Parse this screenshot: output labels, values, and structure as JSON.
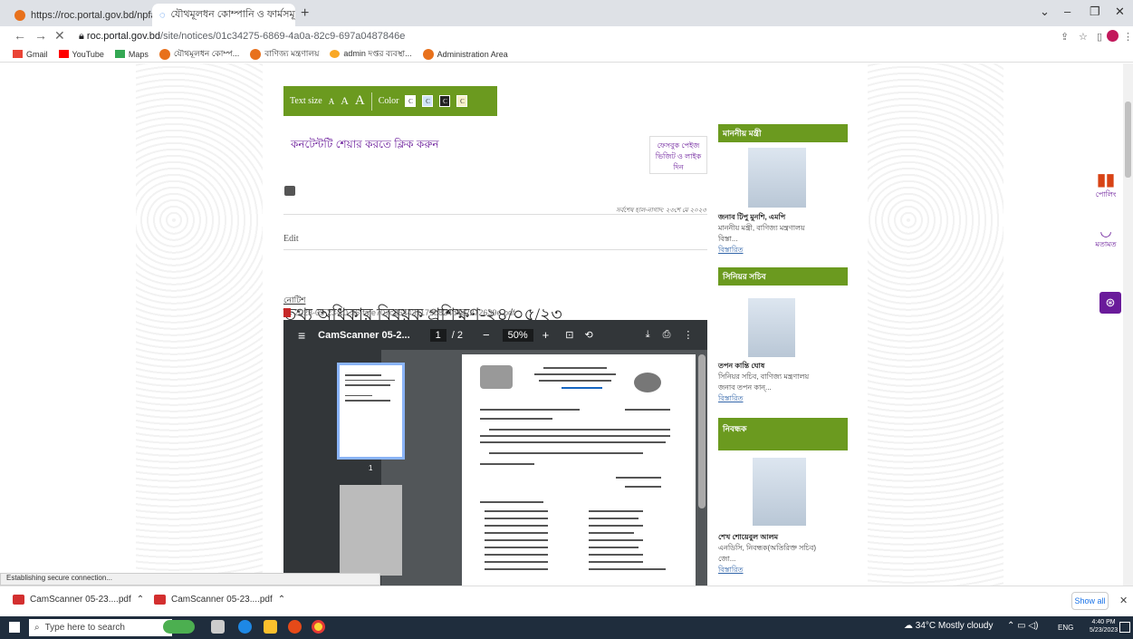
{
  "browser": {
    "tabs": [
      {
        "title": "https://roc.portal.gov.bd/npfadn",
        "active": false
      },
      {
        "title": "যৌথমূলধন কোম্পানি ও ফার্মসমূহ",
        "active": true
      }
    ],
    "url_host": "roc.portal.gov.bd",
    "url_path": "/site/notices/01c34275-6869-4a0a-82c9-697a0487846e",
    "bookmarks": [
      "Gmail",
      "YouTube",
      "Maps",
      "যৌথমূলধন কোম্প...",
      "বাণিজ্য মন্ত্রণালয়",
      "admin দপ্তর ব্যবস্থা...",
      "Administration Area"
    ]
  },
  "toolbar": {
    "text_size_label": "Text size",
    "sizes": [
      "A",
      "A",
      "A"
    ],
    "color_label": "Color",
    "colors": [
      "C",
      "C",
      "C",
      "C"
    ]
  },
  "page": {
    "share_text": "কনটেন্টটি শেয়ার করতে ক্লিক করুন",
    "fb_text": "ফেসবুক পেইজ ভিজিট ও লাইক দিন",
    "updated": "সর্বশেষ হাল-নাগাদ: ২৩শে মে ২০২৩",
    "edit": "Edit",
    "notice_label": "নোটিশ",
    "title": "তথ্য অধিকার বিষয়ক প্রশিক্ষণ-২৪/০৫/২৩",
    "pdf_file": "2023-05-23-10-36-fafe707c264431179b824d4c2272639e.pdf"
  },
  "pdf": {
    "name": "CamScanner 05-2...",
    "page": "1",
    "pages": "/ 2",
    "zoom": "50%",
    "thumb_label": "1"
  },
  "sidebar": {
    "minister_head": "মাননীয় মন্ত্রী",
    "minister_name": "জনাব টিপু মুনশি, এমপি",
    "minister_role": "মাননীয় মন্ত্রী, বাণিজ্য মন্ত্রণালয়",
    "minister_extra": "বিস্তা...",
    "more1": "বিস্তারিত",
    "secretary_head": "সিনিয়র সচিব",
    "secretary_name": "তপন কান্তি ঘোষ",
    "secretary_role": "সিনিয়র সচিব, বাণিজ্য মন্ত্রণালয়",
    "secretary_extra": "জনাব তপন কান্...",
    "more2": "বিস্তারিত",
    "registrar_head": "নিবন্ধক",
    "registrar_name": "শেখ শোয়েবুল আলম",
    "registrar_role": "এনডিসি, নিবন্ধক(অতিরিক্ত সচিব)",
    "registrar_extra": "জো...",
    "more3": "বিস্তারিত"
  },
  "side_icons": {
    "poll": "পোলিং",
    "feedback": "মতামত"
  },
  "status": "Establishing secure connection...",
  "downloads": [
    "CamScanner 05-23....pdf",
    "CamScanner 05-23....pdf"
  ],
  "show_all": "Show all",
  "taskbar": {
    "search": "Type here to search",
    "weather": "34°C  Mostly cloudy",
    "lang": "ENG",
    "time": "4:40 PM",
    "date": "5/23/2023"
  }
}
